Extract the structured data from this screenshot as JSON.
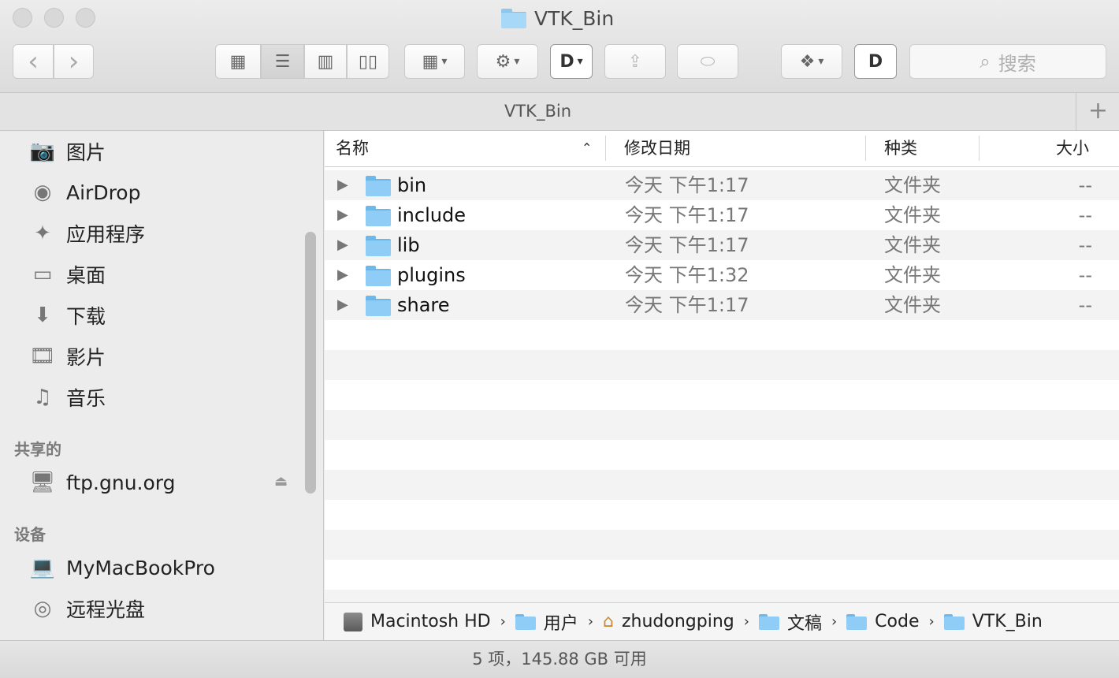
{
  "window": {
    "title": "VTK_Bin"
  },
  "tab": {
    "title": "VTK_Bin",
    "add_label": "+"
  },
  "toolbar": {
    "back": "‹",
    "forward": "›",
    "search_placeholder": "搜索"
  },
  "sidebar": {
    "favorites": [
      {
        "label": "图片",
        "icon": "camera-icon"
      },
      {
        "label": "AirDrop",
        "icon": "airdrop-icon"
      },
      {
        "label": "应用程序",
        "icon": "applications-icon"
      },
      {
        "label": "桌面",
        "icon": "desktop-icon"
      },
      {
        "label": "下载",
        "icon": "download-icon"
      },
      {
        "label": "影片",
        "icon": "film-icon"
      },
      {
        "label": "音乐",
        "icon": "music-icon"
      }
    ],
    "shared_header": "共享的",
    "shared": [
      {
        "label": "ftp.gnu.org",
        "icon": "monitor-icon"
      }
    ],
    "devices_header": "设备",
    "devices": [
      {
        "label": "MyMacBookPro",
        "icon": "laptop-icon"
      },
      {
        "label": "远程光盘",
        "icon": "disc-icon"
      }
    ]
  },
  "columns": {
    "name": "名称",
    "date": "修改日期",
    "kind": "种类",
    "size": "大小"
  },
  "files": [
    {
      "name": "bin",
      "date": "今天 下午1:17",
      "kind": "文件夹",
      "size": "--"
    },
    {
      "name": "include",
      "date": "今天 下午1:17",
      "kind": "文件夹",
      "size": "--"
    },
    {
      "name": "lib",
      "date": "今天 下午1:17",
      "kind": "文件夹",
      "size": "--"
    },
    {
      "name": "plugins",
      "date": "今天 下午1:32",
      "kind": "文件夹",
      "size": "--"
    },
    {
      "name": "share",
      "date": "今天 下午1:17",
      "kind": "文件夹",
      "size": "--"
    }
  ],
  "pathbar": [
    "Macintosh HD",
    "用户",
    "zhudongping",
    "文稿",
    "Code",
    "VTK_Bin"
  ],
  "status": "5 项，145.88 GB 可用"
}
